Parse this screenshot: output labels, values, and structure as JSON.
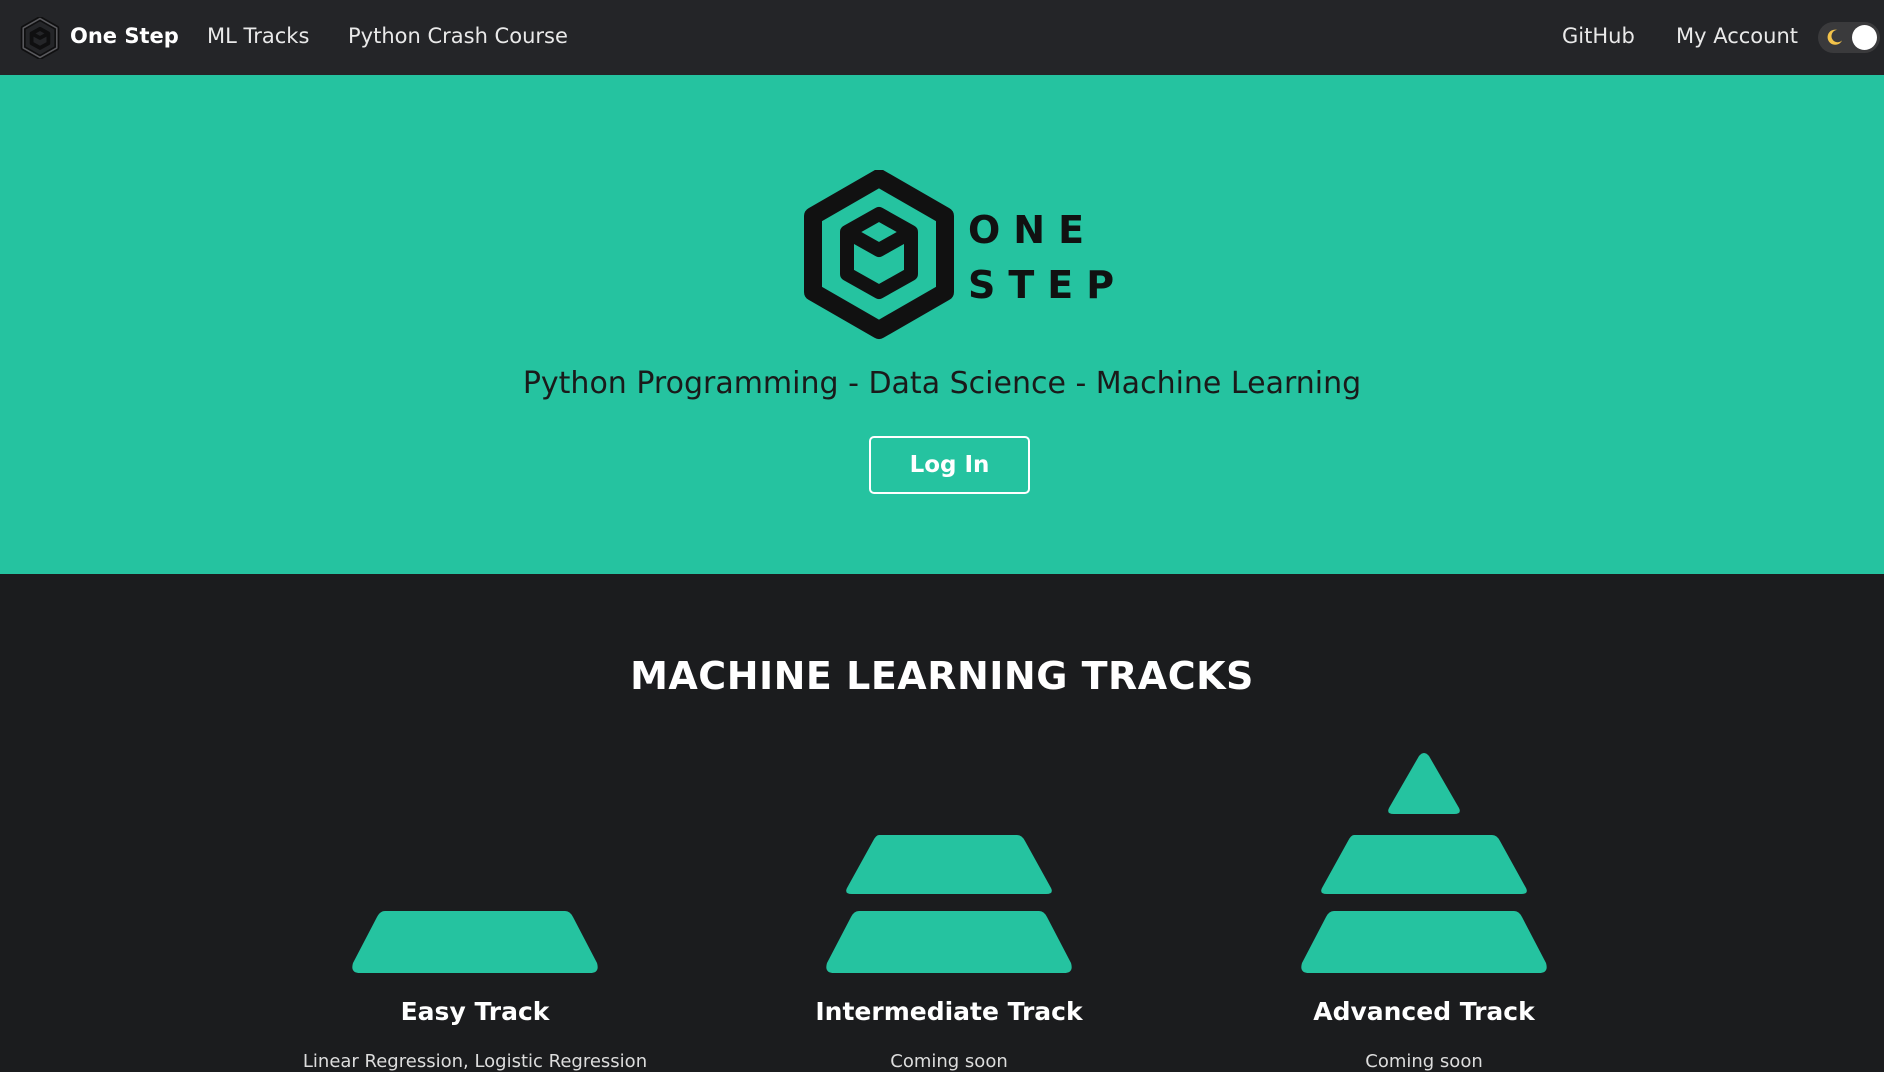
{
  "navbar": {
    "brand": "One Step",
    "links": [
      "ML Tracks",
      "Python Crash Course"
    ],
    "right_links": [
      "GitHub",
      "My Account"
    ],
    "theme_toggle_icon": "moon-icon"
  },
  "hero": {
    "logo_text": [
      "ONE",
      "STEP"
    ],
    "tagline": "Python Programming - Data Science - Machine Learning",
    "login_label": "Log In"
  },
  "tracks_section": {
    "title": "MACHINE LEARNING TRACKS",
    "tracks": [
      {
        "name": "Easy Track",
        "level": 1,
        "description": "Linear Regression, Logistic Regression"
      },
      {
        "name": "Intermediate Track",
        "level": 2,
        "description": "Coming soon"
      },
      {
        "name": "Advanced Track",
        "level": 3,
        "description": "Coming soon"
      }
    ]
  },
  "colors": {
    "accent": "#25c3a0",
    "navbar_bg": "#242528",
    "page_bg": "#1b1c1e"
  }
}
